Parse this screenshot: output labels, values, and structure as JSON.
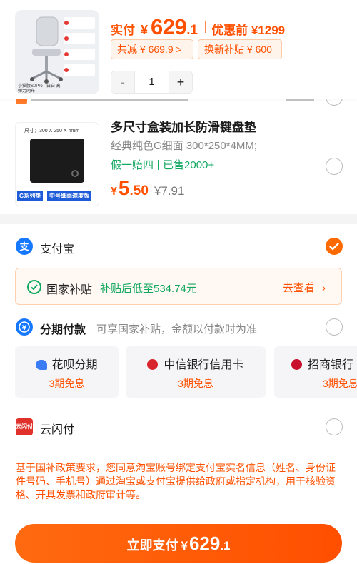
{
  "header": {
    "actual_label": "实付",
    "currency": "¥",
    "price_int": "629",
    "price_dec": ".1",
    "before_label": "优惠前 ¥1299",
    "total_discount": "共减 ¥ 669.9 >",
    "tradein_subsidy": "换新补贴 ¥ 600",
    "quantity": "1",
    "minus": "-",
    "plus": "+",
    "product_image_caption": "小猫腰S0Pro · 白白 高弹力网布"
  },
  "product": {
    "title": "多尺寸盒装加长防滑键盘垫",
    "spec": "经典纯色G细面 300*250*4MM;",
    "tag1": "假一赔四",
    "tag2": "已售2000+",
    "currency": "¥",
    "price_int": "5",
    "price_dec": ".50",
    "original_price": "¥7.91",
    "img_size_label": "尺寸：300 X 250 X 4mm",
    "img_badge1": "G系列垫",
    "img_badge2": "中号细面速度版"
  },
  "payment": {
    "alipay": "支付宝",
    "subsidy_title": "国家补贴",
    "subsidy_text": "补贴后低至534.74元",
    "subsidy_link": "去查看",
    "installment": "分期付款",
    "installment_note": "可享国家补贴，金额以付款时为准",
    "cards": [
      {
        "name": "花呗分期",
        "sub": "3期免息"
      },
      {
        "name": "中信银行信用卡",
        "sub": "3期免息"
      },
      {
        "name": "招商银行",
        "sub": "3期免息"
      }
    ],
    "unionpay": "云闪付",
    "unionpay_icon_text": "云闪付"
  },
  "notice": "基于国补政策要求，您同意淘宝账号绑定支付宝实名信息（姓名、身份证件号码、手机号）通过淘宝或支付宝提供给政府或指定机构，用于核验资格、开具发票和政府审计等。",
  "pay_button": {
    "label": "立即支付",
    "currency": "¥",
    "price_int": "629",
    "price_dec": ".1"
  },
  "colors": {
    "accent": "#ff5000",
    "green": "#12a860",
    "alipay_blue": "#1677ff"
  }
}
